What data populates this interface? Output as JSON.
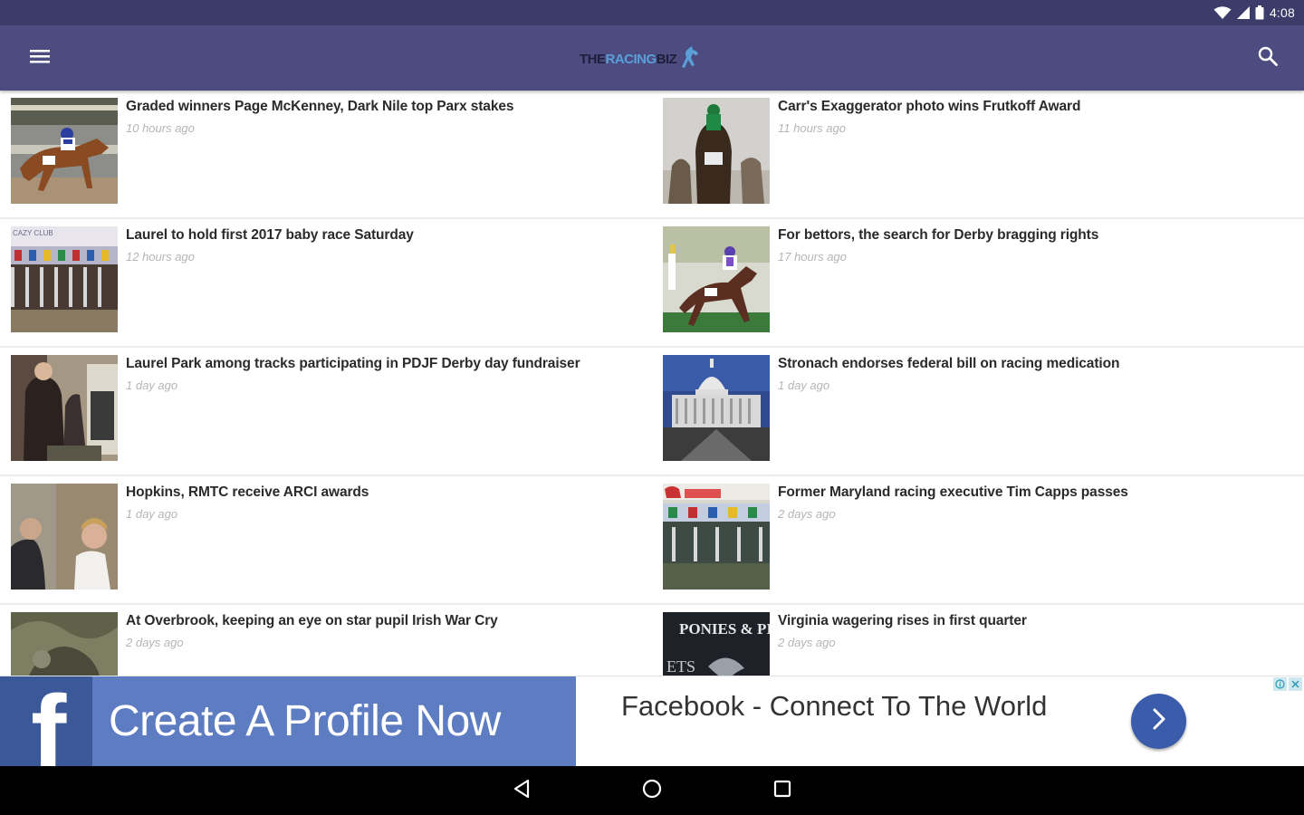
{
  "status_bar": {
    "time": "4:08",
    "icons": [
      "wifi-icon",
      "cell-signal-icon",
      "battery-icon"
    ]
  },
  "app_bar": {
    "background": "#4c4c80",
    "logo": {
      "part1": "THE",
      "part2": "RACING",
      "part3": "BIZ"
    },
    "icons": [
      "hamburger-menu-icon",
      "search-icon"
    ]
  },
  "articles": [
    {
      "title": "Graded winners Page McKenney, Dark Nile top Parx stakes",
      "time": "10 hours ago"
    },
    {
      "title": "Carr's Exaggerator photo wins Frutkoff Award",
      "time": "11 hours ago"
    },
    {
      "title": "Laurel to hold first 2017 baby race Saturday",
      "time": "12 hours ago"
    },
    {
      "title": "For bettors, the search for Derby bragging rights",
      "time": "17 hours ago"
    },
    {
      "title": "Laurel Park among tracks participating in PDJF Derby day fundraiser",
      "time": "1 day ago"
    },
    {
      "title": "Stronach endorses federal bill on racing medication",
      "time": "1 day ago"
    },
    {
      "title": "Hopkins, RMTC receive ARCI awards",
      "time": "1 day ago"
    },
    {
      "title": "Former Maryland racing executive Tim Capps passes",
      "time": "2 days ago"
    },
    {
      "title": "At Overbrook, keeping an eye on star pupil Irish War Cry",
      "time": "2 days ago"
    },
    {
      "title": "Virginia wagering rises in first quarter",
      "time": "2 days ago"
    }
  ],
  "thumbnails": {
    "thumb_3_text": "CAZY CLUB",
    "thumb_8_text": "PONIES & PI",
    "thumb_8_text2": "ETS"
  },
  "ad": {
    "logo_letter": "f",
    "headline": "Create A Profile Now",
    "description": "Facebook - Connect To The World",
    "brand_color": "#3b5998",
    "panel_color": "#5d7cc2",
    "icons": [
      "facebook-logo-icon",
      "chevron-right-icon",
      "ad-info-icon",
      "ad-close-icon"
    ]
  },
  "nav_bar": {
    "icons": [
      "back-triangle-icon",
      "home-circle-icon",
      "recents-square-icon"
    ]
  }
}
